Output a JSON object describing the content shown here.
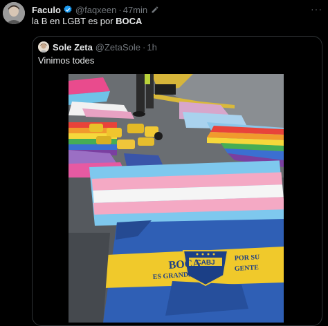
{
  "tweet": {
    "author_name": "Faculo",
    "author_handle": "@faqxeen",
    "separator": "·",
    "time": "47min",
    "text_prefix": "la B en LGBT es por ",
    "text_bold": "BOCA"
  },
  "quote": {
    "author_name": "Sole Zeta",
    "author_handle": "@ZetaSole",
    "separator": "·",
    "time": "1h",
    "text": "Vinimos todes"
  },
  "photo_text": {
    "banner_left_top": "BOCA",
    "banner_left_bottom": "ES GRANDE",
    "badge": "CABJ",
    "banner_right_top": "POR SU",
    "banner_right_bottom": "GENTE"
  },
  "icons": [
    "verified-badge-icon",
    "edit-icon",
    "more-options-icon"
  ],
  "colors": {
    "background": "#000000",
    "text": "#e7e9ea",
    "secondary": "#71767b",
    "verified": "#1d9bf0",
    "border": "#2f3336"
  }
}
